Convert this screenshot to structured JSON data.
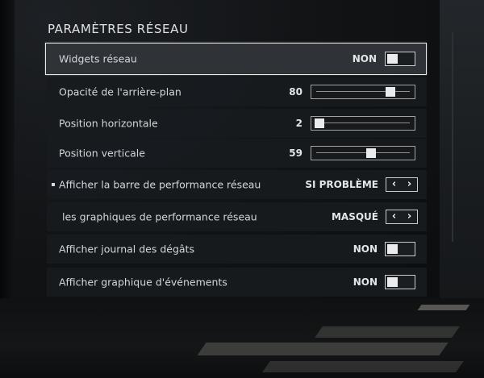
{
  "title": "PARAMÈTRES RÉSEAU",
  "rows": [
    {
      "label": "Widgets réseau",
      "value": "NON",
      "control": "toggle",
      "state": "off",
      "selected": true
    },
    {
      "label": "Opacité de l'arrière-plan",
      "value": "80",
      "control": "slider",
      "level_percent": 80
    },
    {
      "label": "Position horizontale",
      "value": "2",
      "control": "slider",
      "level_percent": 2
    },
    {
      "label": "Position verticale",
      "value": "59",
      "control": "slider",
      "level_percent": 59
    },
    {
      "label": "Afficher la barre de performance réseau",
      "value": "SI PROBLÈME",
      "control": "stepper",
      "bullet": true
    },
    {
      "label": "les graphiques de performance réseau",
      "value": "MASQUÉ",
      "control": "stepper"
    },
    {
      "label": "Afficher journal des dégâts",
      "value": "NON",
      "control": "toggle",
      "state": "off"
    },
    {
      "label": "Afficher graphique d'événements",
      "value": "NON",
      "control": "toggle",
      "state": "off"
    }
  ],
  "stepper_left": "‹",
  "stepper_right": "›",
  "colors": {
    "row_background": "#181b1e",
    "selected_row_background": "#2f3236",
    "selected_border": "#e7e9ea",
    "text": "#d3d7da",
    "knob": "#e9ebec"
  },
  "icons": [
    "bullet-icon",
    "chevron-left-icon",
    "chevron-right-icon"
  ]
}
